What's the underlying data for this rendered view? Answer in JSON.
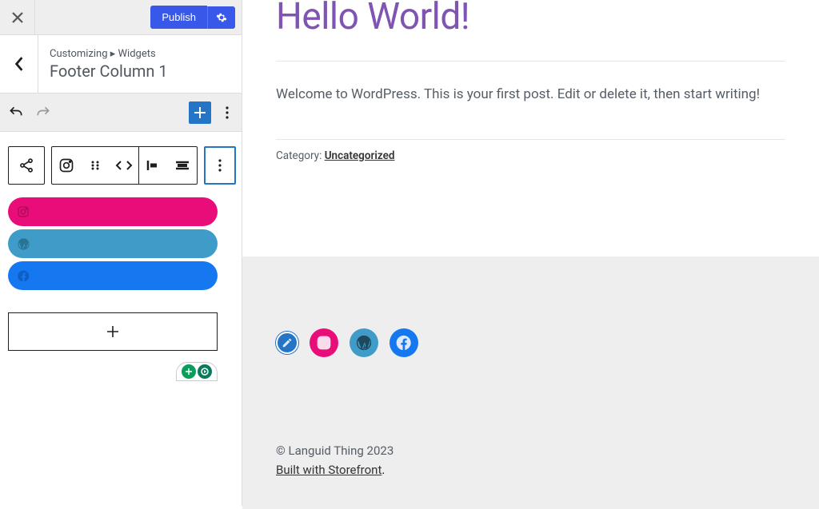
{
  "topbar": {
    "publish_label": "Publish"
  },
  "breadcrumb": {
    "path_prefix": "Customizing",
    "path_link": "Widgets",
    "title": "Footer Column 1"
  },
  "social_links": {
    "items": [
      {
        "name": "instagram",
        "color": "#e90d79"
      },
      {
        "name": "wordpress",
        "color": "#3f9bc7"
      },
      {
        "name": "facebook",
        "color": "#1578f1"
      }
    ]
  },
  "preview": {
    "post_title": "Hello World!",
    "post_body": "Welcome to WordPress. This is your first post. Edit or delete it, then start writing!",
    "category_label": "Category: ",
    "category_value": "Uncategorized",
    "copyright": "© Languid Thing 2023",
    "built_with": "Built with Storefront",
    "built_with_suffix": "."
  },
  "icons": {
    "share": "share-icon",
    "instagram": "instagram-icon",
    "drag": "drag-icon",
    "chevrons": "chevrons-icon",
    "align_left": "align-left-icon",
    "align_justify": "align-justify-icon",
    "more_vertical": "more-vertical-icon",
    "wordpress": "wordpress-icon",
    "facebook": "facebook-icon",
    "pencil": "pencil-icon",
    "plus": "plus-icon",
    "gear": "gear-icon",
    "undo": "undo-icon",
    "redo": "redo-icon",
    "back": "back-icon",
    "close": "close-icon"
  }
}
